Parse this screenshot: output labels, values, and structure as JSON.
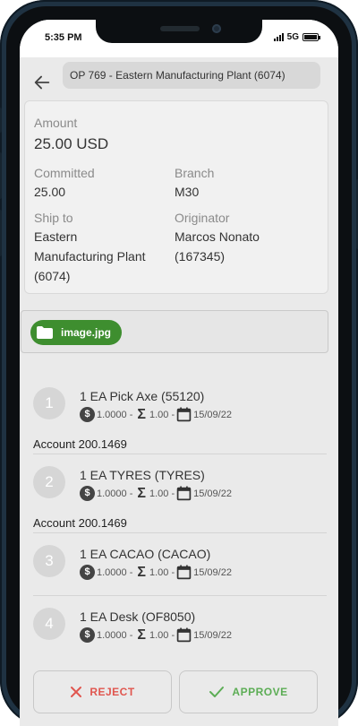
{
  "status_bar": {
    "time": "5:35 PM",
    "network": "5G",
    "battery_level": 1.0
  },
  "header": {
    "back_icon": "arrow-left-icon",
    "title": "OP 769 - Eastern Manufacturing Plant (6074)"
  },
  "summary": {
    "amount_label": "Amount",
    "amount_value": "25.00 USD",
    "committed_label": "Committed",
    "committed_value": "25.00",
    "branch_label": "Branch",
    "branch_value": "M30",
    "ship_to_label": "Ship to",
    "ship_to_value_lines": [
      "Eastern",
      "Manufacturing Plant",
      "(6074)"
    ],
    "originator_label": "Originator",
    "originator_value_lines": [
      "Marcos Nonato",
      "(167345)"
    ]
  },
  "attachments": [
    {
      "icon": "folder-icon",
      "name": "image.jpg",
      "color": "#3e8e2f"
    }
  ],
  "lines": [
    {
      "number": "1",
      "description": "1 EA Pick Axe (55120)",
      "price": "1.0000 -",
      "quantity": "1.00 -",
      "date": "15/09/22",
      "account": "Account 200.1469"
    },
    {
      "number": "2",
      "description": "1 EA TYRES (TYRES)",
      "price": "1.0000 -",
      "quantity": "1.00 -",
      "date": "15/09/22",
      "account": "Account 200.1469"
    },
    {
      "number": "3",
      "description": "1 EA CACAO (CACAO)",
      "price": "1.0000 -",
      "quantity": "1.00 -",
      "date": "15/09/22",
      "account": ""
    },
    {
      "number": "4",
      "description": "1 EA Desk (OF8050)",
      "price": "1.0000 -",
      "quantity": "1.00 -",
      "date": "15/09/22",
      "account": ""
    }
  ],
  "meta_icons": {
    "price": "dollar-coin-icon",
    "quantity": "sigma-icon",
    "date": "calendar-icon"
  },
  "actions": {
    "reject_label": "REJECT",
    "reject_icon": "x-icon",
    "reject_color": "#e0564f",
    "approve_label": "APPROVE",
    "approve_icon": "check-icon",
    "approve_color": "#5cad55"
  }
}
